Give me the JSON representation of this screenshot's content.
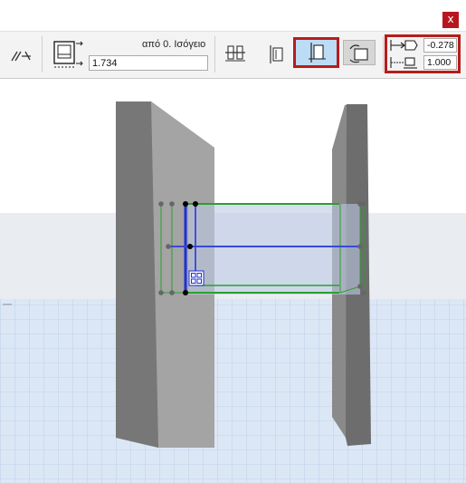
{
  "palette": {
    "close_label": "x",
    "reference_level_label": "από 0. Ισόγειο",
    "elevation_value": "1.734",
    "offset_top_value": "-0.278",
    "offset_bottom_value": "1.000"
  },
  "colors": {
    "highlight_border": "#b71c1c",
    "selected_button_bg": "#bcdcf5",
    "selection_green": "#2ca02c",
    "selection_blue": "#1f2fd6"
  },
  "icons": {
    "toolbar": [
      "link-mirror-icon",
      "elevation-reference-icon",
      "anchor-left-icon",
      "anchor-center-icon",
      "anchor-inside-icon",
      "anchor-outside-icon",
      "offset-top-icon",
      "offset-bottom-icon"
    ],
    "viewport": [
      "edit-handle-icon"
    ]
  }
}
